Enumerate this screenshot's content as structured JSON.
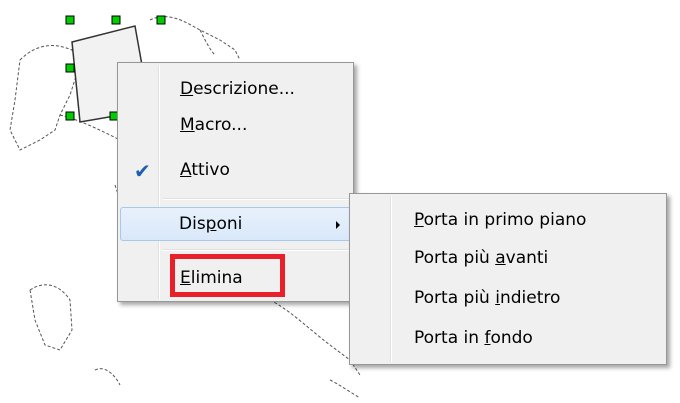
{
  "context_menu": {
    "items": [
      {
        "pre": "",
        "acc": "D",
        "post": "escrizione..."
      },
      {
        "pre": "",
        "acc": "M",
        "post": "acro..."
      },
      {
        "pre": "",
        "acc": "A",
        "post": "ttivo",
        "checked": true
      },
      {
        "pre": "Dis",
        "acc": "p",
        "post": "oni",
        "submenu": true
      },
      {
        "pre": "",
        "acc": "E",
        "post": "limina"
      }
    ],
    "check_glyph": "✔"
  },
  "submenu": {
    "items": [
      {
        "pre": "",
        "acc": "P",
        "post": "orta in primo piano"
      },
      {
        "pre": "Porta più ",
        "acc": "a",
        "post": "vanti"
      },
      {
        "pre": "Porta più ",
        "acc": "i",
        "post": "ndietro"
      },
      {
        "pre": "Porta in ",
        "acc": "f",
        "post": "ondo"
      }
    ]
  },
  "colors": {
    "highlight": "#e8202a",
    "selection_handle": "#00cc00",
    "menu_bg": "#f0f0f0"
  }
}
